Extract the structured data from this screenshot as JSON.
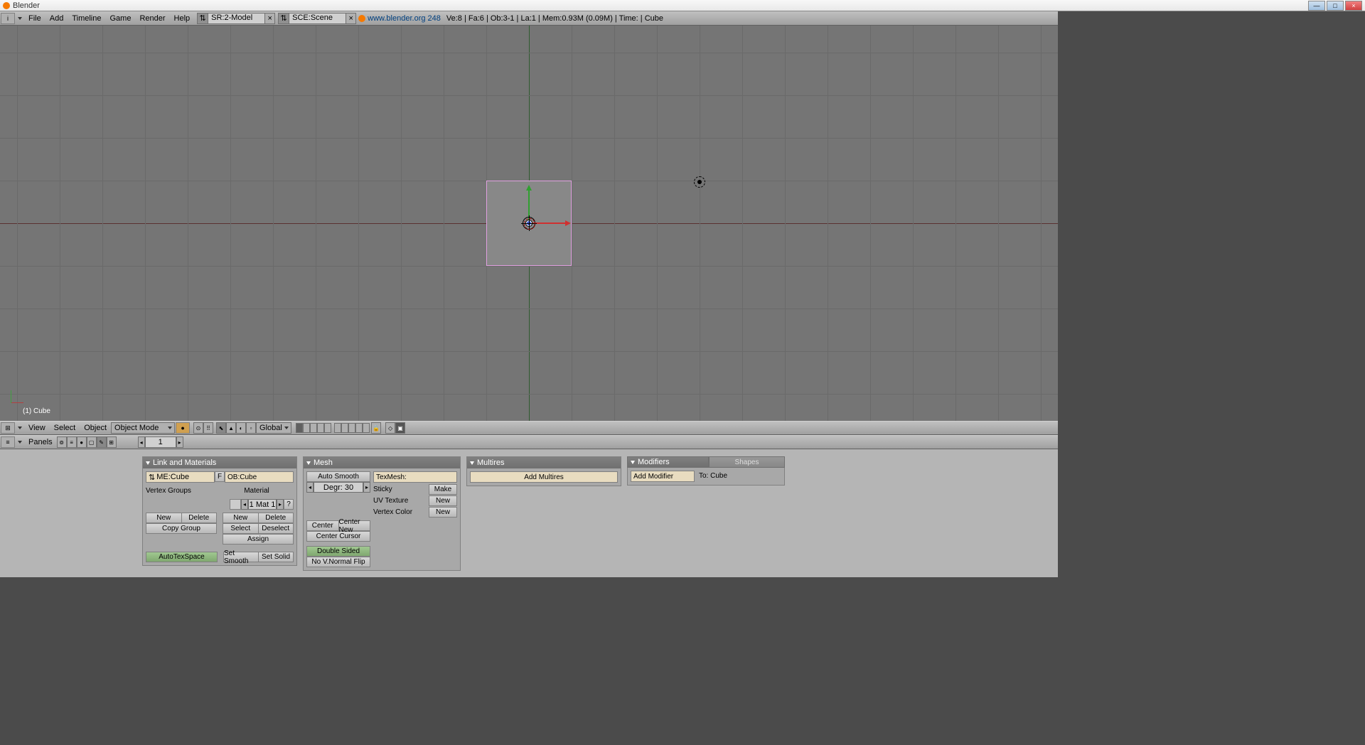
{
  "window": {
    "title": "Blender"
  },
  "topbar": {
    "menus": [
      "File",
      "Add",
      "Timeline",
      "Game",
      "Render",
      "Help"
    ],
    "screen_field": "SR:2-Model",
    "scene_field": "SCE:Scene",
    "link": "www.blender.org 248",
    "stats": "Ve:8 | Fa:6 | Ob:3-1 | La:1 | Mem:0.93M (0.09M) | Time: | Cube"
  },
  "viewport": {
    "label": "(1) Cube"
  },
  "view_header": {
    "menus": [
      "View",
      "Select",
      "Object"
    ],
    "mode": "Object Mode",
    "orientation": "Global"
  },
  "btn_header": {
    "label": "Panels",
    "frame": "1"
  },
  "panels": {
    "link_mat": {
      "title": "Link and Materials",
      "me_field": "ME:Cube",
      "f_label": "F",
      "ob_field": "OB:Cube",
      "vg_label": "Vertex Groups",
      "mat_label": "Material",
      "mat_index": "1 Mat 1",
      "q": "?",
      "new": "New",
      "delete": "Delete",
      "copy_group": "Copy Group",
      "select": "Select",
      "deselect": "Deselect",
      "assign": "Assign",
      "autotex": "AutoTexSpace",
      "set_smooth": "Set Smooth",
      "set_solid": "Set Solid"
    },
    "mesh": {
      "title": "Mesh",
      "auto_smooth": "Auto Smooth",
      "degr": "Degr: 30",
      "texmesh": "TexMesh:",
      "sticky": "Sticky",
      "make": "Make",
      "uvtex": "UV Texture",
      "new1": "New",
      "vcolor": "Vertex Color",
      "new2": "New",
      "center": "Center",
      "center_new": "Center New",
      "center_cursor": "Center Cursor",
      "double_sided": "Double Sided",
      "no_vnormal": "No V.Normal Flip"
    },
    "multires": {
      "title": "Multires",
      "add": "Add Multires"
    },
    "modifiers": {
      "title": "Modifiers",
      "shapes_tab": "Shapes",
      "add": "Add Modifier",
      "to": "To: Cube"
    }
  }
}
